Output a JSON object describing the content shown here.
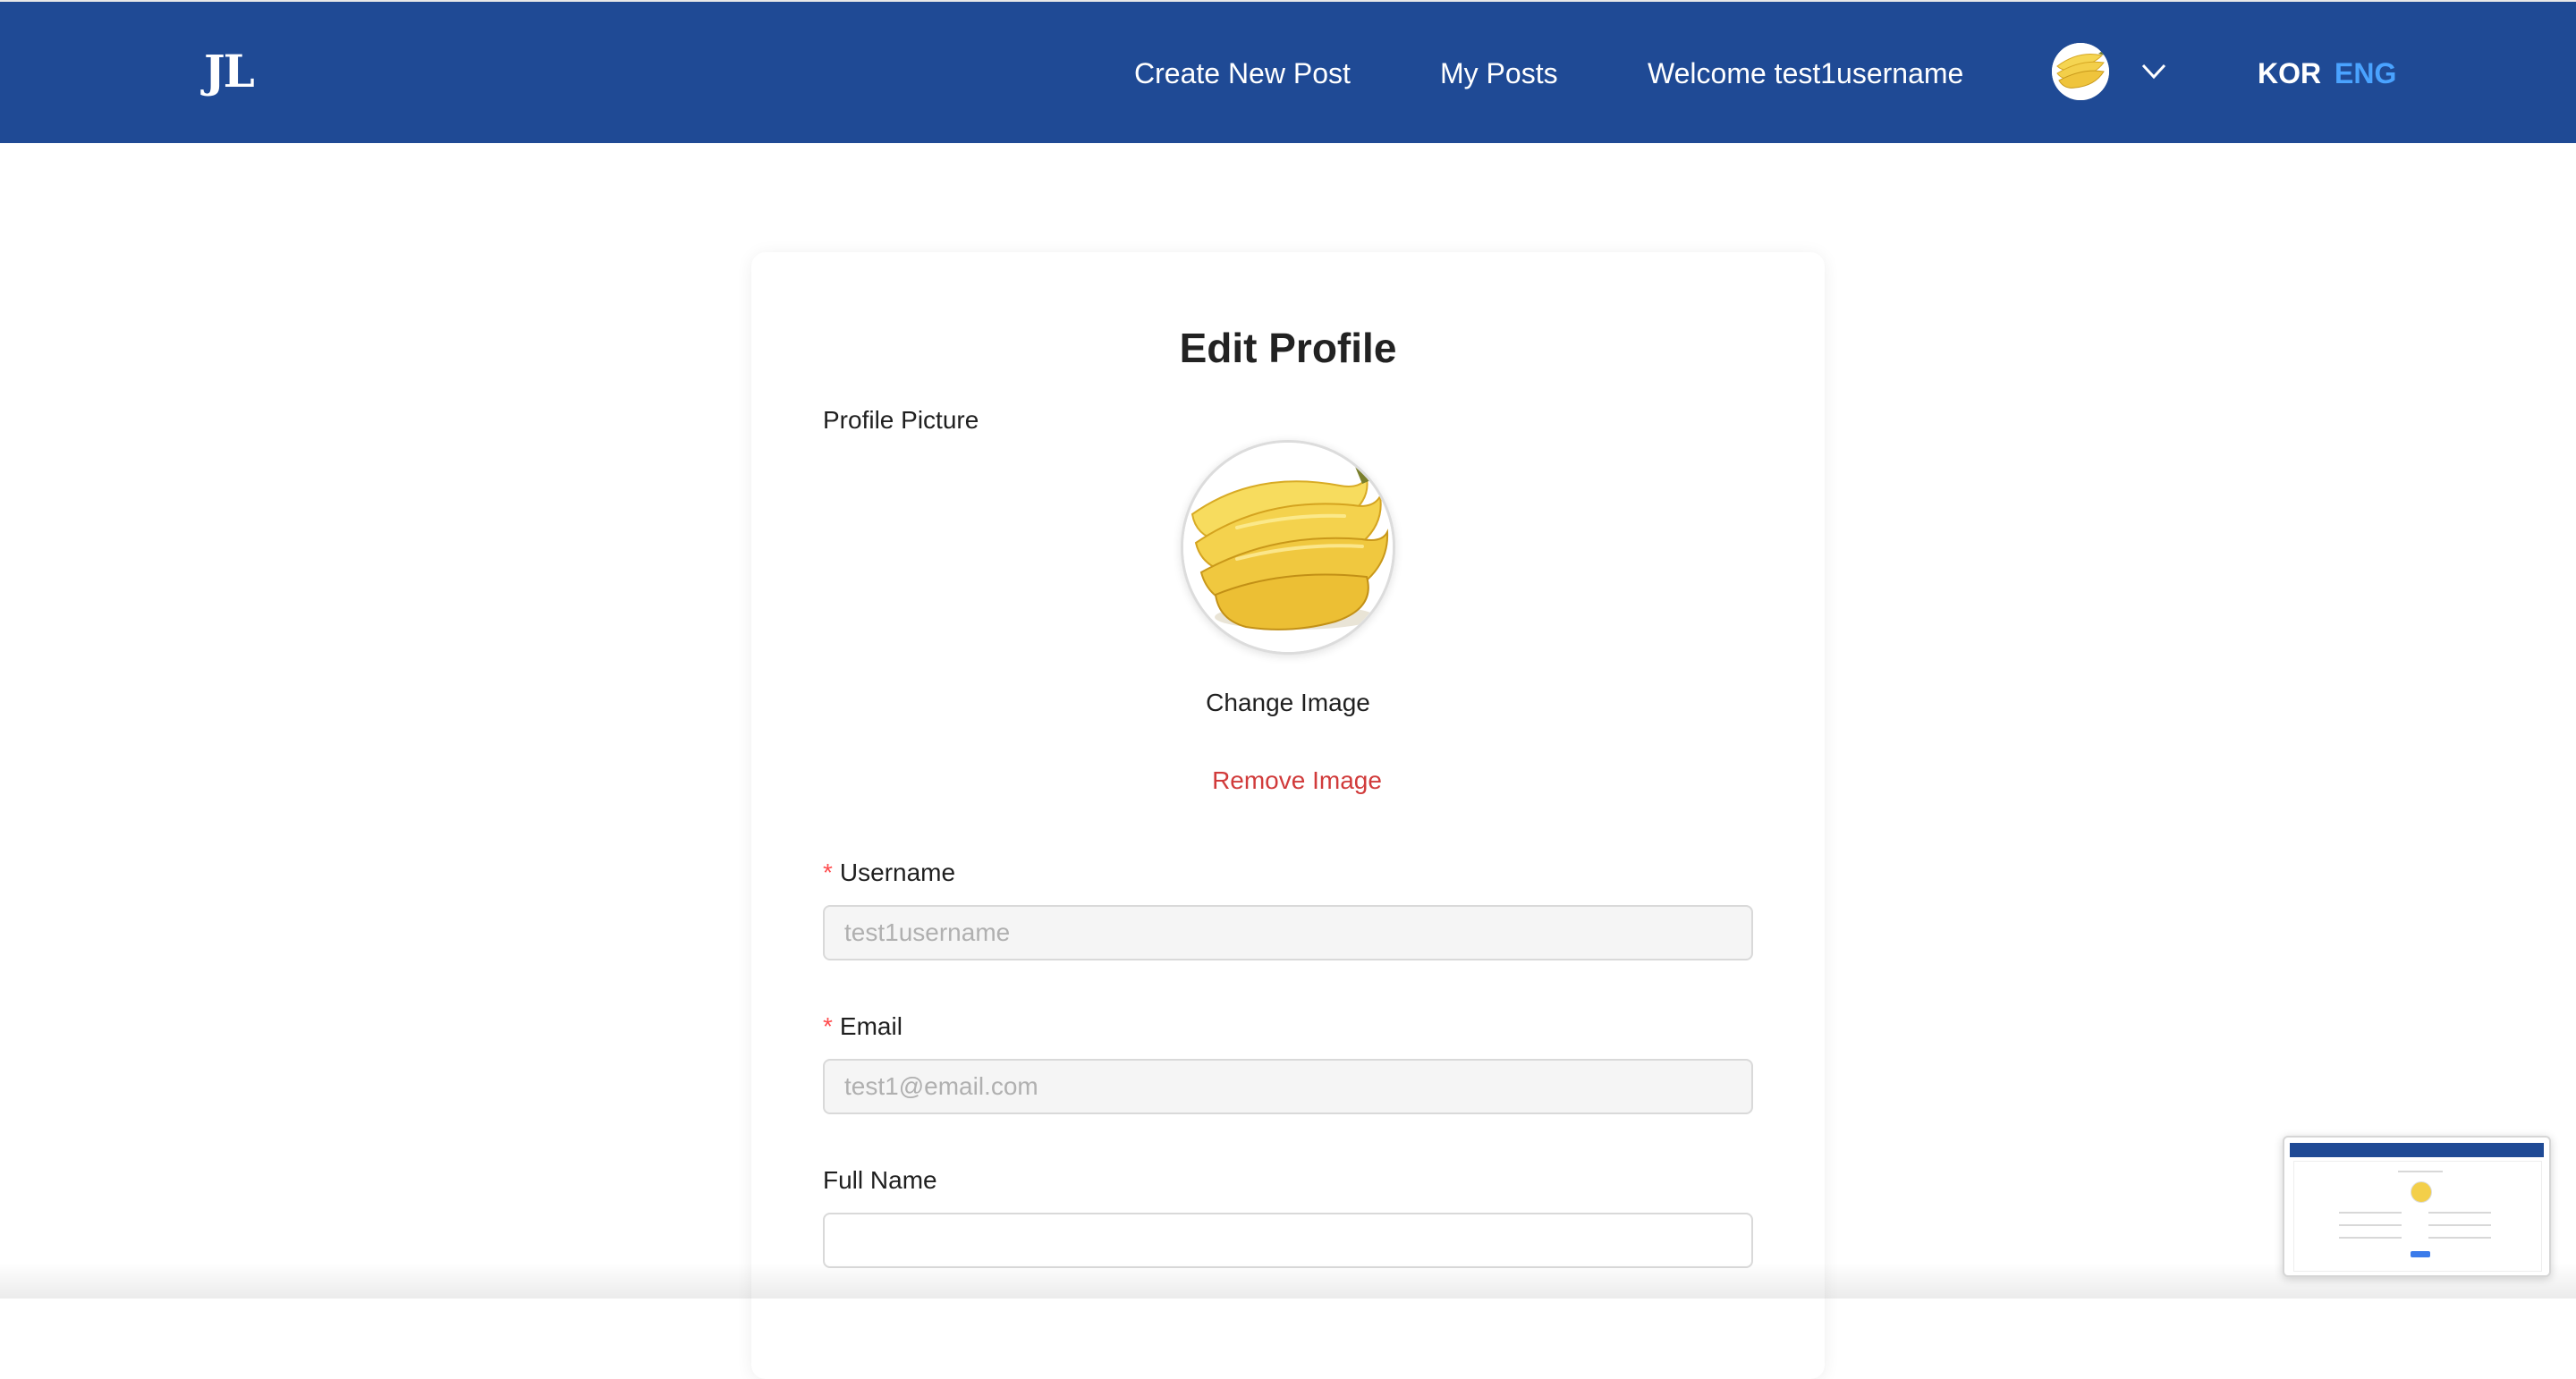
{
  "header": {
    "logo": "JL",
    "nav": {
      "create_post": "Create New Post",
      "my_posts": "My Posts",
      "welcome": "Welcome test1username"
    },
    "avatar_icon": "banana-avatar",
    "dropdown_icon": "chevron-down-icon",
    "languages": {
      "kor": "KOR",
      "eng": "ENG",
      "active": "ENG"
    }
  },
  "profile_form": {
    "title": "Edit Profile",
    "picture_label": "Profile Picture",
    "picture_icon": "banana-image",
    "change_image": "Change Image",
    "remove_image": "Remove Image",
    "required_mark": "*",
    "username": {
      "label": "Username",
      "placeholder": "test1username",
      "value": "",
      "required": true,
      "disabled": true
    },
    "email": {
      "label": "Email",
      "placeholder": "test1@email.com",
      "value": "",
      "required": true,
      "disabled": true
    },
    "full_name": {
      "label": "Full Name",
      "placeholder": "",
      "value": "",
      "required": false,
      "disabled": false
    }
  },
  "colors": {
    "navbar": "#1f4a95",
    "active_language": "#4aa3ff",
    "danger": "#d13b3b",
    "required": "#ff4d4f",
    "banana": "#f3cf4a"
  }
}
